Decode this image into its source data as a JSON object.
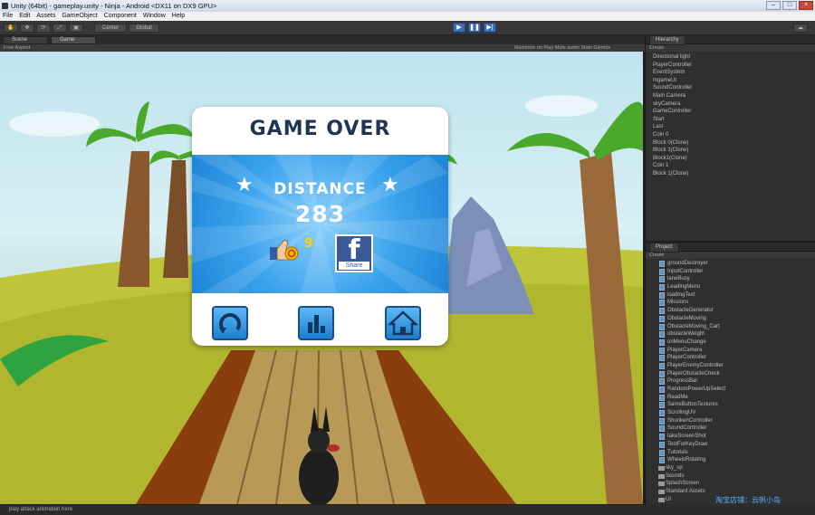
{
  "window": {
    "title": "Unity (64bit) - gameplay.unity - Ninja - Android <DX11 on DX9 GPU>"
  },
  "menu": [
    "File",
    "Edit",
    "Assets",
    "GameObject",
    "Component",
    "Window",
    "Help"
  ],
  "toolbar": {
    "pivot_label": "Center",
    "space_label": "Global"
  },
  "tabs": [
    "Scene",
    "Game"
  ],
  "gamebar": {
    "aspect": "Free Aspect",
    "right": "Maximize on Play   Mute audio   Stats   Gizmos"
  },
  "dialog": {
    "title": "GAME OVER",
    "distance_label": "DISTANCE",
    "distance_value": "283",
    "coins": "9",
    "facebook_label": "Share"
  },
  "hierarchy": {
    "title": "Hierarchy",
    "create": "Create",
    "items": [
      "Directional light",
      "PlayerController",
      "EventSystem",
      "IngameUI",
      "SoundController",
      "Main Camera",
      "skyCamera",
      "GameController",
      "Start",
      "Last",
      "Coin 0",
      "Block 0(Clone)",
      "Block 1(Clone)",
      "Block1(Clone)",
      "Coin 1",
      "Block 1(Clone)"
    ]
  },
  "project": {
    "title": "Project",
    "create": "Create",
    "scripts": [
      "groundDestroyer",
      "InputController",
      "laneBusy",
      "LeadingMenu",
      "loadingText",
      "Missions",
      "ObstacleGenerator",
      "ObstacleMoving",
      "ObstacleMoving_Cart",
      "obstacleWeight",
      "onMenuChange",
      "PlayerCamera",
      "PlayerController",
      "PlayerEnemyController",
      "PlayerObstacleCheck",
      "ProgressBar",
      "RandomPowerUpSelect",
      "ReadMe",
      "SameButtonTextures",
      "ScrollingUV",
      "ShurikenController",
      "SoundController",
      "takeScreenShot",
      "TestForKeyDraw",
      "Tutorials",
      "WheelsRotating"
    ],
    "folders": [
      "sky_sp",
      "Sounds",
      "SplashScreen",
      "Standard Assets",
      "UI"
    ]
  },
  "status": "play attack animation here",
  "watermark": "淘宝店铺：云帆小岛",
  "colors": {
    "dialog_title": "#1e3553",
    "burst": "#3aa2ec",
    "facebook": "#3b5998",
    "coins": "#ffd000"
  }
}
